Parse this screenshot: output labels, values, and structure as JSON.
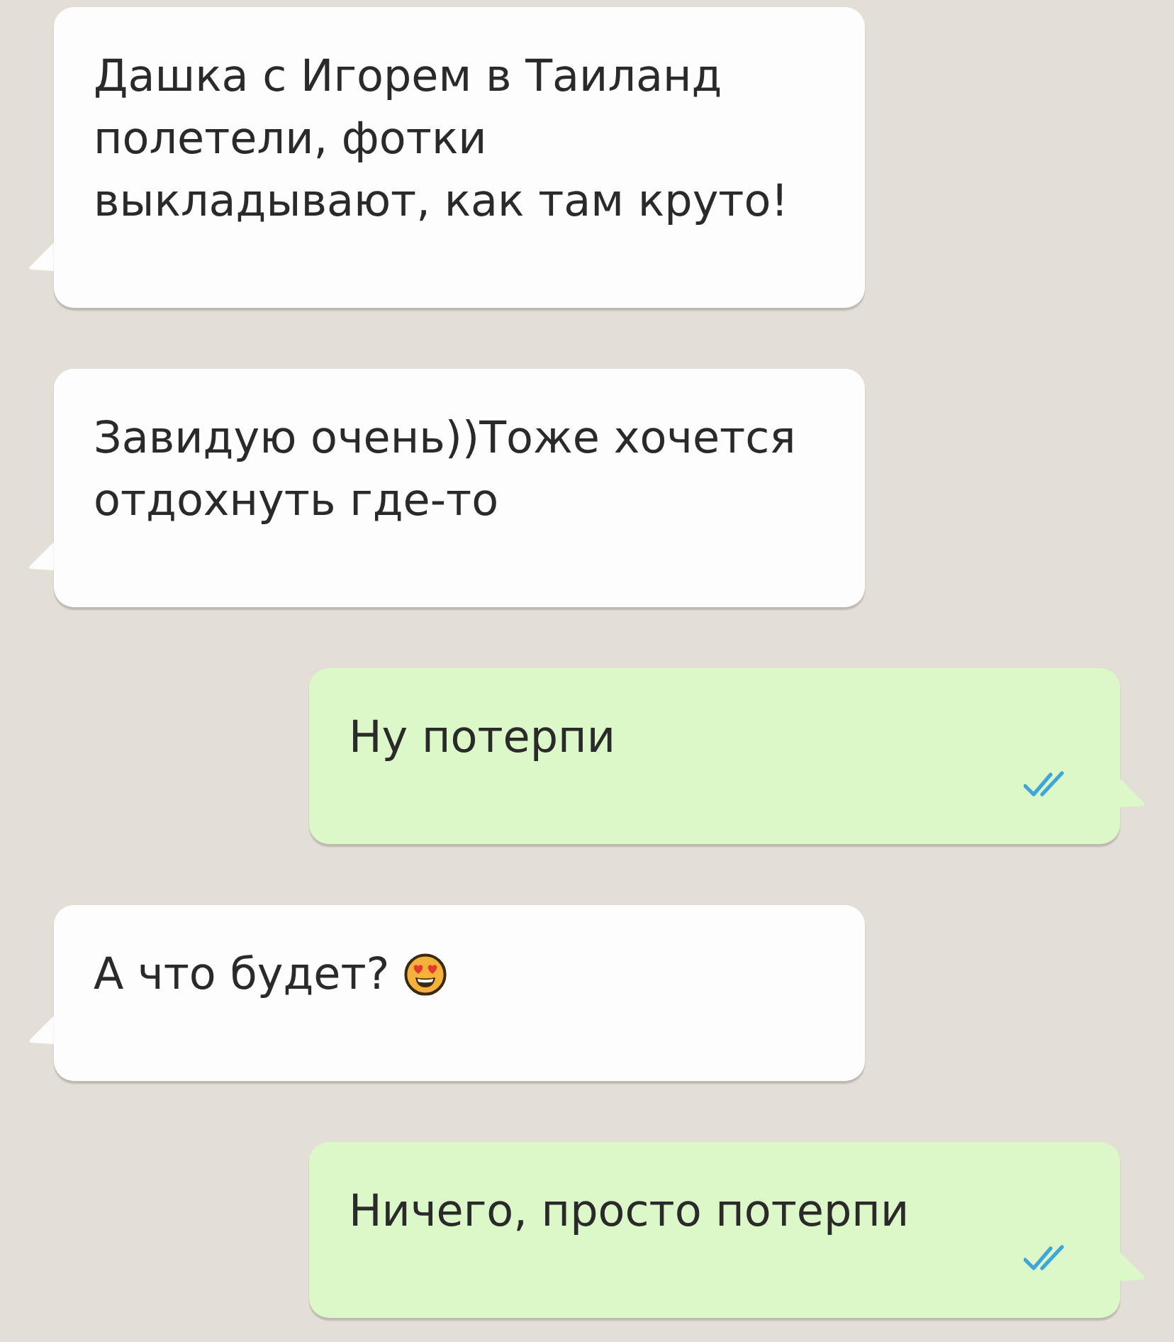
{
  "chat": {
    "messages": [
      {
        "kind": "incoming",
        "text": "Дашка с Игорем в Таиланд полетели, фотки выкладывают, как там круто!"
      },
      {
        "kind": "incoming",
        "text": "Завидую очень))Тоже хочется отдохнуть где-то"
      },
      {
        "kind": "outgoing",
        "text": "Ну потерпи",
        "read": true
      },
      {
        "kind": "incoming",
        "text": "А что будет?",
        "emoji": true
      },
      {
        "kind": "outgoing",
        "text": "Ничего, просто потерпи",
        "read": true
      }
    ]
  }
}
